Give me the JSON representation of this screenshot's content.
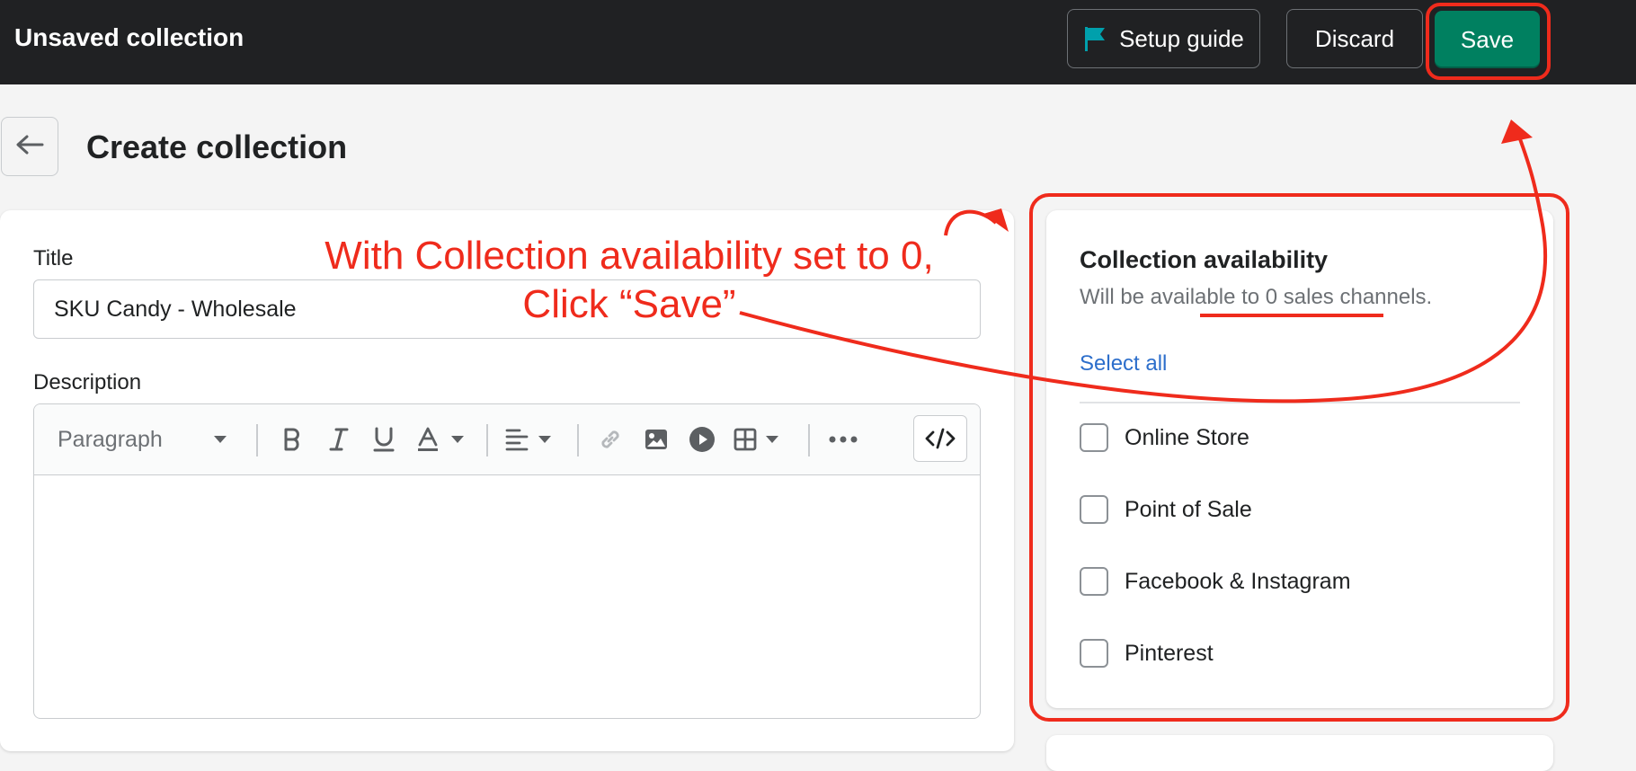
{
  "topbar": {
    "title": "Unsaved collection",
    "setup_guide_label": "Setup guide",
    "discard_label": "Discard",
    "save_label": "Save",
    "save_color": "#008060"
  },
  "header": {
    "title": "Create collection"
  },
  "form": {
    "title_label": "Title",
    "title_value": "SKU Candy - Wholesale",
    "description_label": "Description",
    "toolbar": {
      "paragraph_label": "Paragraph",
      "icons": [
        "bold-icon",
        "italic-icon",
        "underline-icon",
        "text-color-icon",
        "align-icon",
        "link-icon",
        "image-icon",
        "video-icon",
        "table-icon",
        "more-icon",
        "code-icon"
      ]
    }
  },
  "availability": {
    "title": "Collection availability",
    "subtitle": "Will be available to 0 sales channels.",
    "select_all_label": "Select all",
    "channels": [
      {
        "label": "Online Store",
        "checked": false
      },
      {
        "label": "Point of Sale",
        "checked": false
      },
      {
        "label": "Facebook & Instagram",
        "checked": false
      },
      {
        "label": "Pinterest",
        "checked": false
      }
    ]
  },
  "annotation": {
    "line1": "With Collection availability set to 0,",
    "line2": "Click “Save”",
    "color": "#ef2b1c"
  }
}
